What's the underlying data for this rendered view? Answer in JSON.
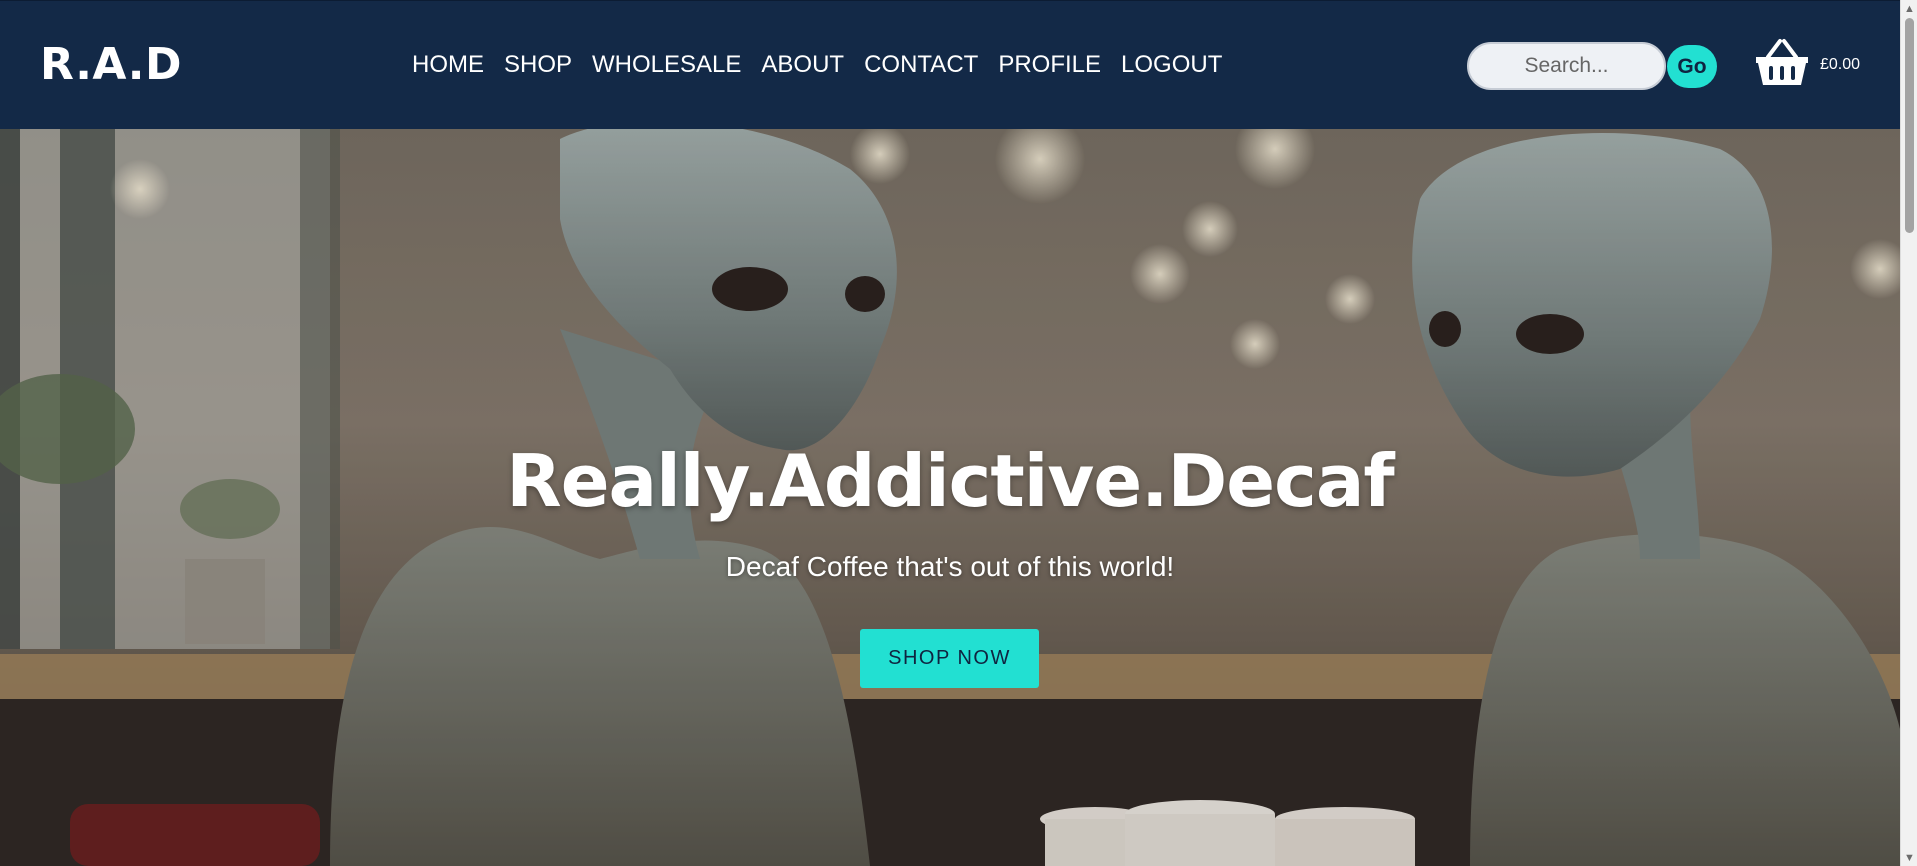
{
  "header": {
    "logo": "R.A.D",
    "nav": [
      {
        "label": "HOME"
      },
      {
        "label": "SHOP"
      },
      {
        "label": "WHOLESALE"
      },
      {
        "label": "ABOUT"
      },
      {
        "label": "CONTACT"
      },
      {
        "label": "PROFILE"
      },
      {
        "label": "LOGOUT"
      }
    ],
    "search": {
      "placeholder": "Search...",
      "value": "",
      "button_label": "Go"
    },
    "cart": {
      "icon": "shopping-basket-icon",
      "total": "£0.00"
    }
  },
  "hero": {
    "title": "Really.Addictive.Decaf",
    "subtitle": "Decaf Coffee that's out of this world!",
    "cta_label": "SHOP NOW",
    "background": "photo-two-aliens-drinking-coffee-in-cafe"
  },
  "colors": {
    "navbar": "#132947",
    "accent": "#22e0d2",
    "text_light": "#ffffff"
  }
}
